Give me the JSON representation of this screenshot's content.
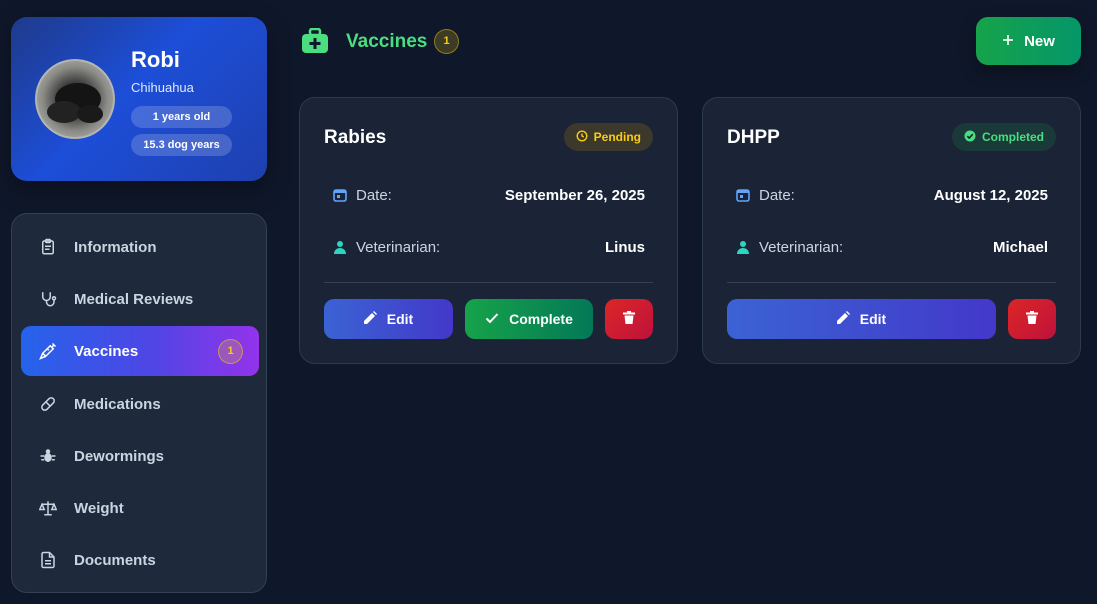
{
  "pet": {
    "name": "Robi",
    "breed": "Chihuahua",
    "age": "1 years old",
    "dog_years": "15.3 dog years"
  },
  "sidebar": {
    "items": [
      {
        "label": "Information",
        "icon": "clipboard-icon"
      },
      {
        "label": "Medical Reviews",
        "icon": "stethoscope-icon"
      },
      {
        "label": "Vaccines",
        "icon": "syringe-icon",
        "badge": "1",
        "active": true
      },
      {
        "label": "Medications",
        "icon": "pill-icon"
      },
      {
        "label": "Dewormings",
        "icon": "bug-icon"
      },
      {
        "label": "Weight",
        "icon": "scale-icon"
      },
      {
        "label": "Documents",
        "icon": "document-icon"
      }
    ]
  },
  "header": {
    "title": "Vaccines",
    "count": "1",
    "new_label": "New"
  },
  "labels": {
    "date": "Date:",
    "veterinarian": "Veterinarian:",
    "edit": "Edit",
    "complete": "Complete"
  },
  "vaccines": [
    {
      "name": "Rabies",
      "status": "Pending",
      "date": "September 26, 2025",
      "veterinarian": "Linus"
    },
    {
      "name": "DHPP",
      "status": "Completed",
      "date": "August 12, 2025",
      "veterinarian": "Michael"
    }
  ],
  "colors": {
    "background": "#0f172a",
    "accent_green": "#4ade80",
    "pending": "#facc15",
    "delete": "#dc2626"
  }
}
